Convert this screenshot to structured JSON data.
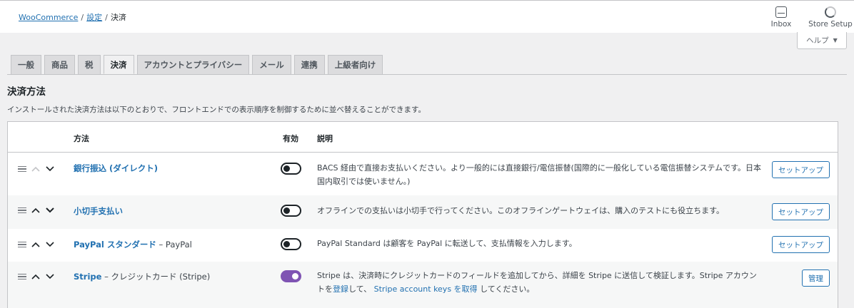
{
  "breadcrumb": {
    "root": "WooCommerce",
    "settings": "設定",
    "current": "決済"
  },
  "topbar": {
    "inbox_label": "Inbox",
    "setup_label": "Store Setup",
    "help_label": "ヘルプ"
  },
  "tabs": [
    "一般",
    "商品",
    "税",
    "決済",
    "アカウントとプライバシー",
    "メール",
    "連携",
    "上級者向け"
  ],
  "active_tab": "決済",
  "section": {
    "title": "決済方法",
    "description": "インストールされた決済方法は以下のとおりで、フロントエンドでの表示順序を制御するために並べ替えることができます。"
  },
  "table": {
    "headers": {
      "method": "方法",
      "enabled": "有効",
      "description": "説明"
    },
    "rows": [
      {
        "name": "銀行振込 (ダイレクト)",
        "subtitle": "",
        "enabled": false,
        "description": "BACS 経由で直接お支払いください。より一般的には直接銀行/電信振替(国際的に一般化している電信振替システムです。日本国内取引では使いません。)",
        "action": "セットアップ"
      },
      {
        "name": "小切手支払い",
        "subtitle": "",
        "enabled": false,
        "description": "オフラインでの支払いは小切手で行ってください。このオフラインゲートウェイは、購入のテストにも役立ちます。",
        "action": "セットアップ"
      },
      {
        "name": "PayPal スタンダード",
        "subtitle": "– PayPal",
        "enabled": false,
        "description": "PayPal Standard は顧客を PayPal に転送して、支払情報を入力します。",
        "action": "セットアップ"
      },
      {
        "name": "Stripe",
        "subtitle": "– クレジットカード (Stripe)",
        "enabled": true,
        "description_parts": {
          "before": "Stripe は、決済時にクレジットカードのフィールドを追加してから、詳細を Stripe に送信して検証します。Stripe アカウントを",
          "link1": "登録",
          "middle": "して、",
          "link2": "Stripe account keys を取得",
          "after": "してください。"
        },
        "action": "管理"
      }
    ]
  }
}
